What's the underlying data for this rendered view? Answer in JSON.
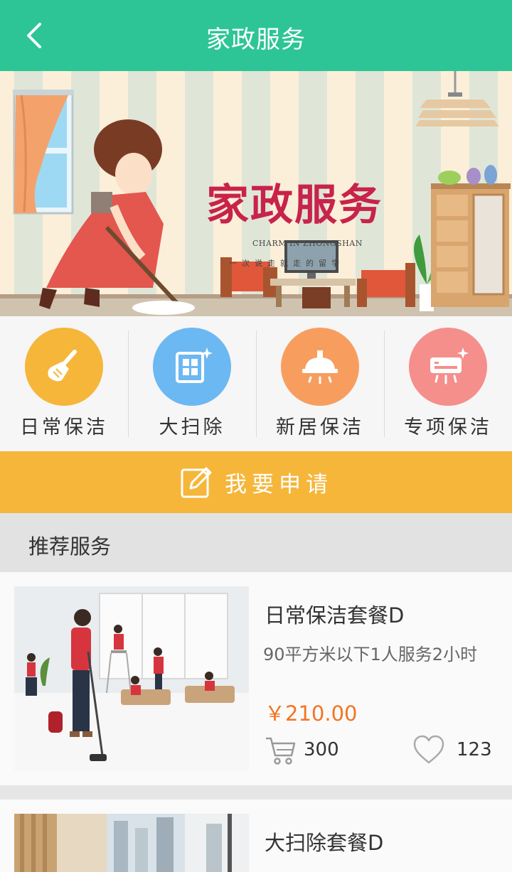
{
  "header": {
    "title": "家政服务",
    "back_icon": "chevron-left-icon"
  },
  "banner": {
    "title": "家政服务",
    "subtitle": "CHARM IN ZHONGSHAN",
    "tagline": "一次说走就走的留学"
  },
  "categories": [
    {
      "label": "日常保洁",
      "icon": "broom-icon",
      "color": "#f5b63a"
    },
    {
      "label": "大扫除",
      "icon": "window-clean-icon",
      "color": "#6cb8f2"
    },
    {
      "label": "新居保洁",
      "icon": "ceiling-lamp-icon",
      "color": "#f79e5f"
    },
    {
      "label": "专项保洁",
      "icon": "air-conditioner-icon",
      "color": "#f58f8c"
    }
  ],
  "apply": {
    "label": "我要申请",
    "icon": "edit-icon"
  },
  "section": {
    "title": "推荐服务"
  },
  "services": [
    {
      "name": "日常保洁套餐D",
      "desc": "90平方米以下1人服务2小时",
      "price": "￥210.00",
      "sales": "300",
      "likes": "123"
    },
    {
      "name": "大扫除套餐D"
    }
  ],
  "colors": {
    "header": "#2dc595",
    "apply": "#f5b63a",
    "price": "#f47421"
  }
}
